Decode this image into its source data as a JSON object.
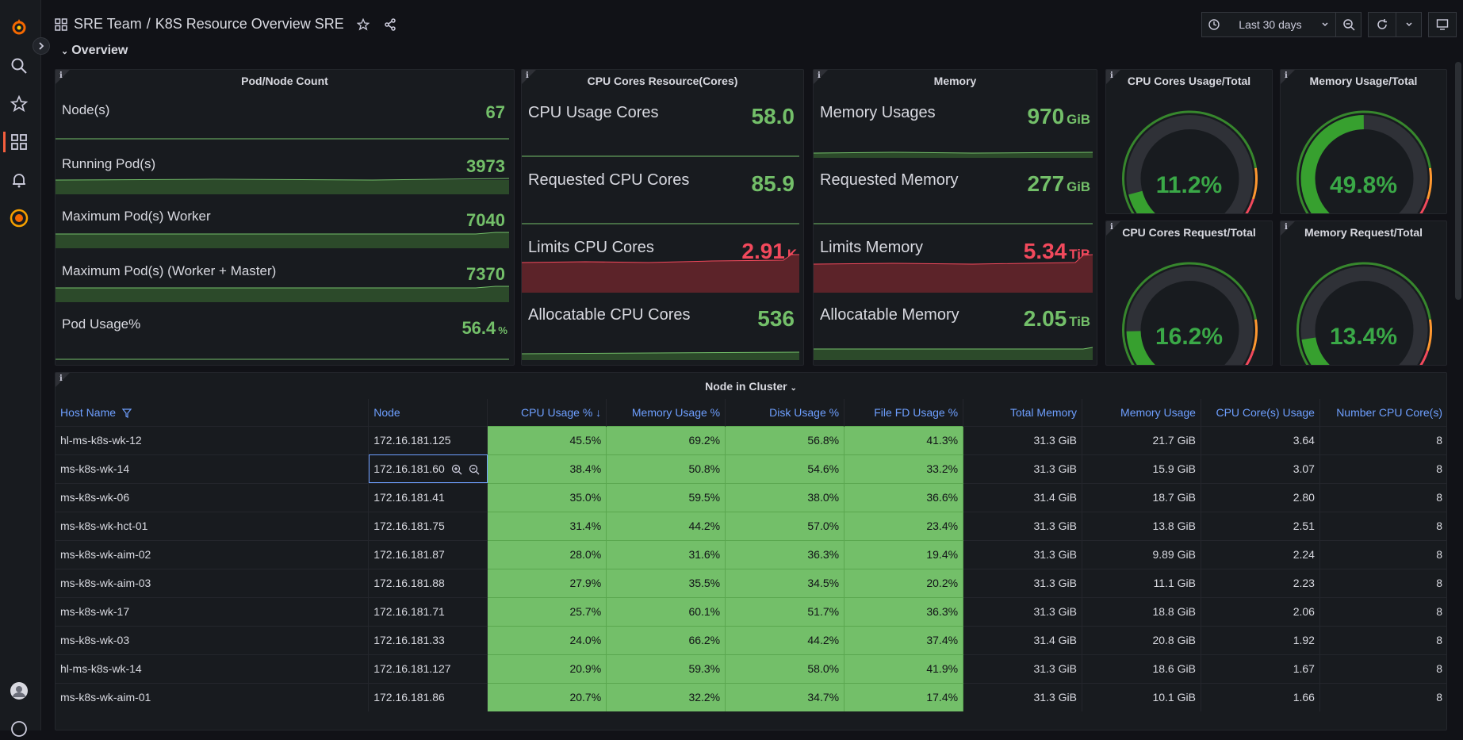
{
  "breadcrumb": {
    "folder": "SRE Team",
    "separator": "/",
    "dashboard": "K8S Resource Overview SRE"
  },
  "toolbar": {
    "time_range": "Last 30 days"
  },
  "row": {
    "title": "Overview"
  },
  "pod_panel": {
    "title": "Pod/Node Count",
    "stats": [
      {
        "label": "Node(s)",
        "value": "67",
        "unit": ""
      },
      {
        "label": "Running Pod(s)",
        "value": "3973",
        "unit": ""
      },
      {
        "label": "Maximum Pod(s) Worker",
        "value": "7040",
        "unit": ""
      },
      {
        "label": "Maximum Pod(s) (Worker + Master)",
        "value": "7370",
        "unit": ""
      },
      {
        "label": "Pod Usage%",
        "value": "56.4",
        "unit": "%"
      }
    ]
  },
  "cpu_panel": {
    "title": "CPU Cores Resource(Cores)",
    "stats": [
      {
        "label": "CPU Usage Cores",
        "value": "58.0",
        "unit": ""
      },
      {
        "label": "Requested CPU Cores",
        "value": "85.9",
        "unit": ""
      },
      {
        "label": "Limits CPU Cores",
        "value": "2.91",
        "unit": "K"
      },
      {
        "label": "Allocatable CPU Cores",
        "value": "536",
        "unit": ""
      }
    ]
  },
  "mem_panel": {
    "title": "Memory",
    "stats": [
      {
        "label": "Memory Usages",
        "value": "970",
        "unit": "GiB"
      },
      {
        "label": "Requested Memory",
        "value": "277",
        "unit": "GiB"
      },
      {
        "label": "Limits Memory",
        "value": "5.34",
        "unit": "TiB"
      },
      {
        "label": "Allocatable Memory",
        "value": "2.05",
        "unit": "TiB"
      }
    ]
  },
  "gauges": [
    {
      "title": "CPU Cores Usage/Total",
      "value": "11.2%",
      "fraction": 0.112
    },
    {
      "title": "Memory Usage/Total",
      "value": "49.8%",
      "fraction": 0.498
    },
    {
      "title": "CPU Cores Request/Total",
      "value": "16.2%",
      "fraction": 0.162
    },
    {
      "title": "Memory Request/Total",
      "value": "13.4%",
      "fraction": 0.134
    }
  ],
  "colors": {
    "green": "#73bf69",
    "red": "#f2495c",
    "gauge_green": "#37872d",
    "orange": "#ff9830",
    "accent": "#6e9fff"
  },
  "table": {
    "title": "Node in Cluster",
    "columns": [
      "Host Name",
      "Node",
      "CPU Usage %",
      "Memory Usage %",
      "Disk Usage %",
      "File FD Usage %",
      "Total Memory",
      "Memory Usage",
      "CPU Core(s) Usage",
      "Number CPU Core(s)"
    ],
    "rows": [
      [
        "hl-ms-k8s-wk-12",
        "172.16.181.125",
        "45.5%",
        "69.2%",
        "56.8%",
        "41.3%",
        "31.3 GiB",
        "21.7 GiB",
        "3.64",
        "8"
      ],
      [
        "ms-k8s-wk-14",
        "172.16.181.60",
        "38.4%",
        "50.8%",
        "54.6%",
        "33.2%",
        "31.3 GiB",
        "15.9 GiB",
        "3.07",
        "8"
      ],
      [
        "ms-k8s-wk-06",
        "172.16.181.41",
        "35.0%",
        "59.5%",
        "38.0%",
        "36.6%",
        "31.4 GiB",
        "18.7 GiB",
        "2.80",
        "8"
      ],
      [
        "ms-k8s-wk-hct-01",
        "172.16.181.75",
        "31.4%",
        "44.2%",
        "57.0%",
        "23.4%",
        "31.3 GiB",
        "13.8 GiB",
        "2.51",
        "8"
      ],
      [
        "ms-k8s-wk-aim-02",
        "172.16.181.87",
        "28.0%",
        "31.6%",
        "36.3%",
        "19.4%",
        "31.3 GiB",
        "9.89 GiB",
        "2.24",
        "8"
      ],
      [
        "ms-k8s-wk-aim-03",
        "172.16.181.88",
        "27.9%",
        "35.5%",
        "34.5%",
        "20.2%",
        "31.3 GiB",
        "11.1 GiB",
        "2.23",
        "8"
      ],
      [
        "ms-k8s-wk-17",
        "172.16.181.71",
        "25.7%",
        "60.1%",
        "51.7%",
        "36.3%",
        "31.3 GiB",
        "18.8 GiB",
        "2.06",
        "8"
      ],
      [
        "ms-k8s-wk-03",
        "172.16.181.33",
        "24.0%",
        "66.2%",
        "44.2%",
        "37.4%",
        "31.4 GiB",
        "20.8 GiB",
        "1.92",
        "8"
      ],
      [
        "hl-ms-k8s-wk-14",
        "172.16.181.127",
        "20.9%",
        "59.3%",
        "58.0%",
        "41.9%",
        "31.3 GiB",
        "18.6 GiB",
        "1.67",
        "8"
      ],
      [
        "ms-k8s-wk-aim-01",
        "172.16.181.86",
        "20.7%",
        "32.2%",
        "34.7%",
        "17.4%",
        "31.3 GiB",
        "10.1 GiB",
        "1.66",
        "8"
      ]
    ]
  }
}
